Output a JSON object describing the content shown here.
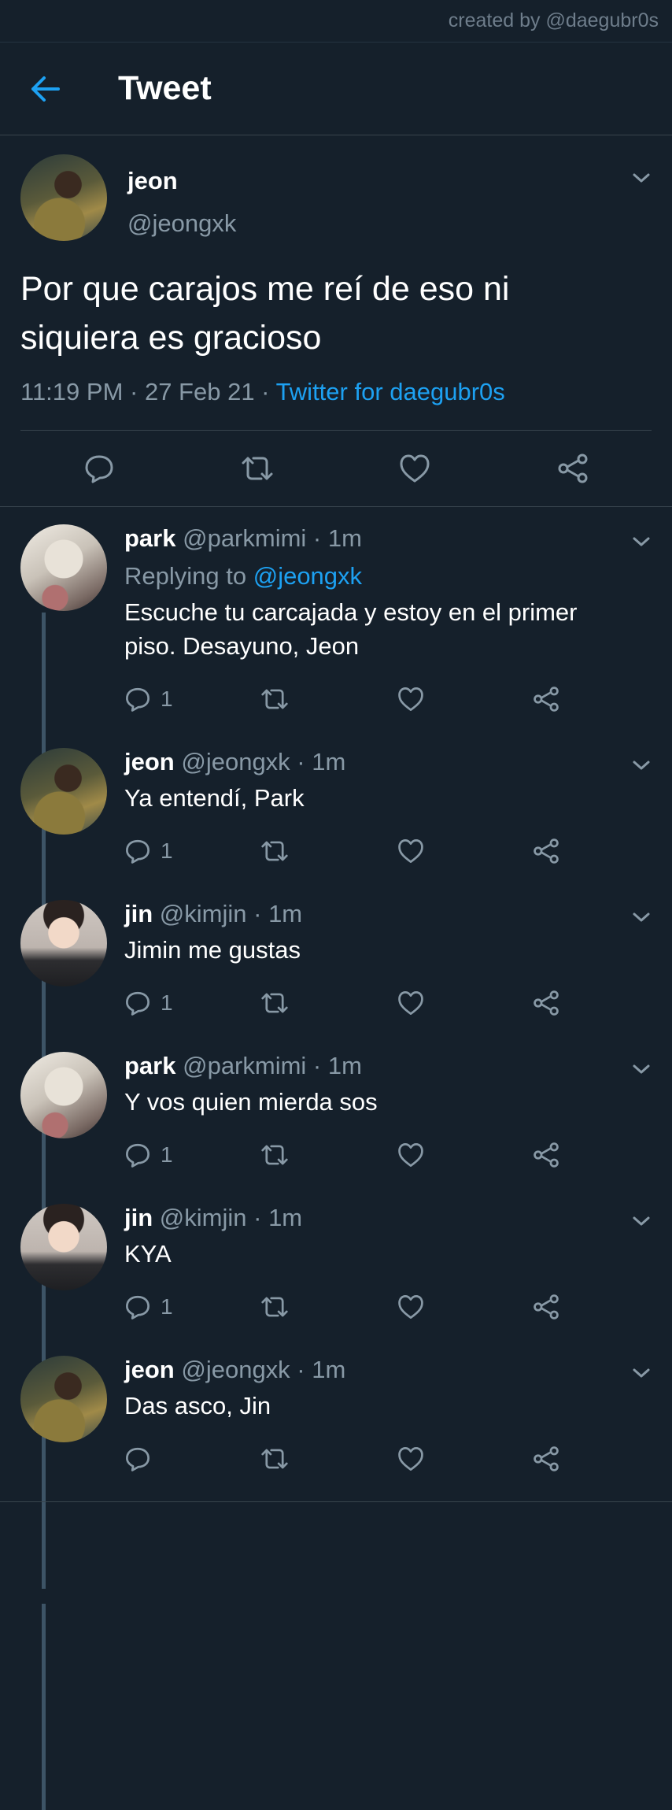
{
  "credit": "created by @daegubr0s",
  "header": {
    "title": "Tweet"
  },
  "main_tweet": {
    "name": "jeon",
    "handle": "@jeongxk",
    "text_line1": "Por que carajos me reí de eso ni",
    "text_line2": "siquiera es gracioso",
    "time": "11:19 PM",
    "date": "27 Feb 21",
    "source": "Twitter for daegubr0s"
  },
  "replies": [
    {
      "name": "park",
      "handle": "@parkmimi",
      "time": "1m",
      "replying_prefix": "Replying to ",
      "replying_to": "@jeongxk",
      "text_line1": "Escuche tu carcajada y estoy en el primer",
      "text_line2": "piso. Desayuno, Jeon",
      "reply_count": "1"
    },
    {
      "name": "jeon",
      "handle": "@jeongxk",
      "time": "1m",
      "text_line1": "Ya entendí, Park",
      "reply_count": "1"
    },
    {
      "name": "jin",
      "handle": "@kimjin",
      "time": "1m",
      "text_line1": "Jimin me gustas",
      "reply_count": "1"
    },
    {
      "name": "park",
      "handle": "@parkmimi",
      "time": "1m",
      "text_line1": "Y vos quien mierda sos",
      "reply_count": "1"
    },
    {
      "name": "jin",
      "handle": "@kimjin",
      "time": "1m",
      "text_line1": "KYA",
      "reply_count": "1"
    },
    {
      "name": "jeon",
      "handle": "@jeongxk",
      "time": "1m",
      "text_line1": "Das asco, Jin",
      "reply_count": ""
    }
  ],
  "separator": " · ",
  "colors": {
    "background": "#15202b",
    "accent": "#1da1f2",
    "secondary_text": "#8899a6",
    "divider": "#38444d"
  },
  "icons": [
    "back-arrow-icon",
    "chevron-down-icon",
    "reply-icon",
    "retweet-icon",
    "like-icon",
    "share-icon"
  ]
}
